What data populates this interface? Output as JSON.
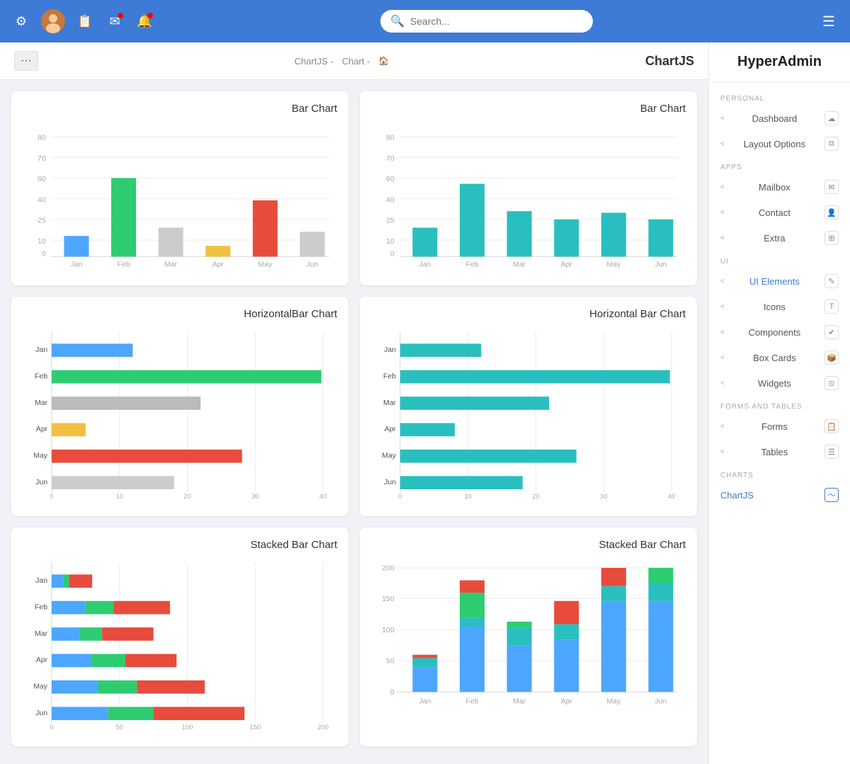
{
  "brand": "HyperAdmin",
  "topnav": {
    "search_placeholder": "Search..."
  },
  "breadcrumb": {
    "path": [
      "ChartJS -",
      "Chart -",
      "🏠"
    ],
    "title": "ChartJS"
  },
  "sidebar": {
    "sections": [
      {
        "label": "PERSONAL",
        "items": [
          {
            "name": "Dashboard",
            "icon": "☁",
            "arrow": "<"
          },
          {
            "name": "Layout Options",
            "icon": "⧉",
            "arrow": "<"
          }
        ]
      },
      {
        "label": "APPS",
        "items": [
          {
            "name": "Mailbox",
            "icon": "✉",
            "arrow": "<"
          },
          {
            "name": "Contact",
            "icon": "👤",
            "arrow": "<"
          },
          {
            "name": "Extra",
            "icon": "⊞",
            "arrow": "<"
          }
        ]
      },
      {
        "label": "UI",
        "items": [
          {
            "name": "UI Elements",
            "icon": "✎",
            "arrow": "<"
          },
          {
            "name": "Icons",
            "icon": "T",
            "arrow": "<"
          },
          {
            "name": "Components",
            "icon": "✔",
            "arrow": "<"
          },
          {
            "name": "Box Cards",
            "icon": "📦",
            "arrow": "<"
          },
          {
            "name": "Widgets",
            "icon": "⊙",
            "arrow": "<"
          }
        ]
      },
      {
        "label": "FORMS And TABLES",
        "items": [
          {
            "name": "Forms",
            "icon": "📋",
            "arrow": "<"
          },
          {
            "name": "Tables",
            "icon": "☰",
            "arrow": "<"
          }
        ]
      },
      {
        "label": "CHARTS",
        "items": [
          {
            "name": "ChartJS",
            "icon": "~",
            "arrow": "",
            "active": true
          }
        ]
      }
    ]
  },
  "charts": [
    {
      "title": "Bar Chart",
      "type": "bar-multi"
    },
    {
      "title": "Bar Chart",
      "type": "bar-mono"
    },
    {
      "title": "HorizontalBar Chart",
      "type": "hbar-multi"
    },
    {
      "title": "Horizontal Bar Chart",
      "type": "hbar-mono"
    },
    {
      "title": "Stacked Bar Chart",
      "type": "stacked-hbar-multi"
    },
    {
      "title": "Stacked Bar Chart",
      "type": "stacked-bar-vertical"
    }
  ]
}
